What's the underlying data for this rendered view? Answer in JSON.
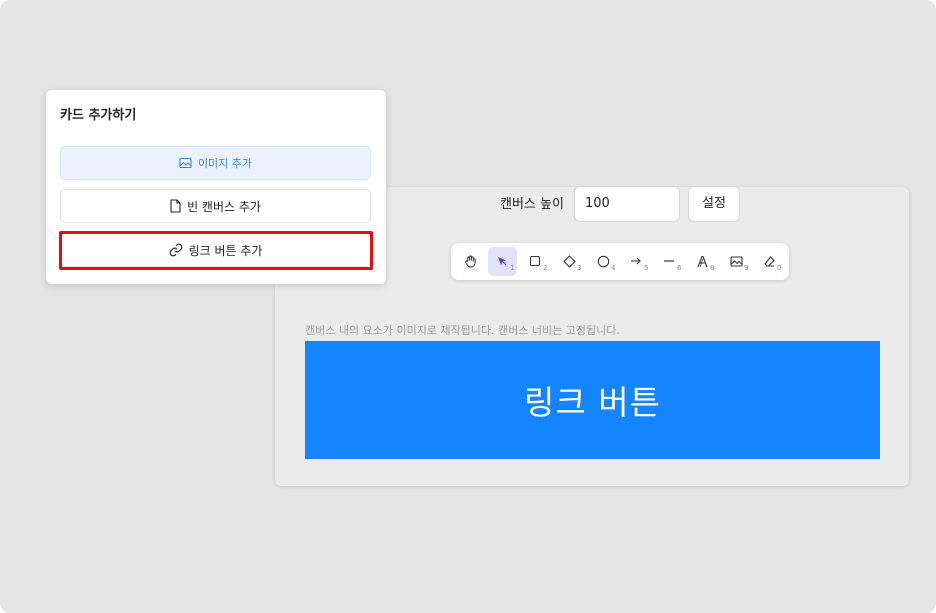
{
  "card": {
    "title": "카드 추가하기",
    "options": [
      {
        "label": "이미지 추가",
        "icon": "image-icon"
      },
      {
        "label": "빈 캔버스 추가",
        "icon": "file-icon"
      },
      {
        "label": "링크 버튼 추가",
        "icon": "link-icon"
      }
    ]
  },
  "editor": {
    "height_label": "캔버스 높이",
    "height_value": "100",
    "set_label": "설정",
    "hint": "캔버스 내의 요소가 이미지로 제작됩니다. 캔버스 너비는 고정됩니다.",
    "canvas_text": "링크 버튼",
    "canvas_color": "#1485fe",
    "tools": [
      {
        "name": "hand-icon",
        "key": ""
      },
      {
        "name": "pointer-icon",
        "key": "1"
      },
      {
        "name": "rectangle-icon",
        "key": "2"
      },
      {
        "name": "diamond-icon",
        "key": "3"
      },
      {
        "name": "circle-icon",
        "key": "4"
      },
      {
        "name": "arrow-icon",
        "key": "5"
      },
      {
        "name": "line-icon",
        "key": "6"
      },
      {
        "name": "text-icon",
        "key": "8"
      },
      {
        "name": "image-icon",
        "key": "9"
      },
      {
        "name": "eraser-icon",
        "key": "0"
      }
    ]
  },
  "colors": {
    "highlight": "#e01010",
    "accent": "#3b82d6",
    "active_tool": "#e2e0fb"
  }
}
